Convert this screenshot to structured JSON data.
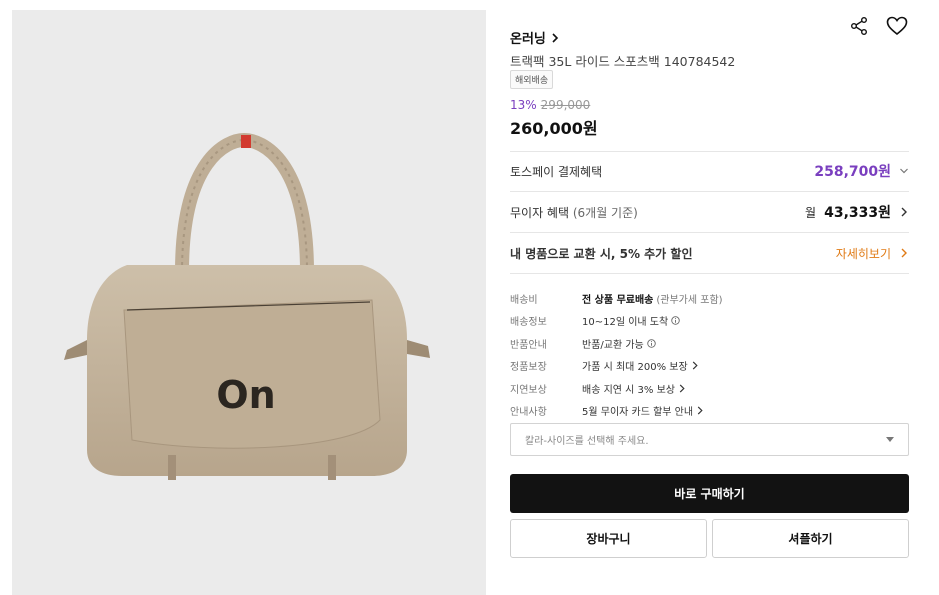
{
  "product": {
    "brand": "온러닝",
    "name": "트랙팩 35L 라이드 스포츠백 140784542",
    "badge": "해외배송",
    "discount_rate": "13%",
    "original_price": "299,000",
    "price": "260,000원"
  },
  "benefits": {
    "toss_label": "토스페이 결제혜택",
    "toss_price": "258,700원",
    "muija_label": "무이자 혜택",
    "muija_sub": "(6개월 기준)",
    "muija_unit": "월",
    "muija_price": "43,333원",
    "promo_label": "내 명품으로 교환 시, 5% 추가 할인",
    "promo_link": "자세히보기"
  },
  "delivery": [
    {
      "key": "배송비",
      "bold": "전 상품 무료배송",
      "muted": "(관부가세 포함)",
      "value": "",
      "icon": "none"
    },
    {
      "key": "배송정보",
      "bold": "",
      "muted": "",
      "value": "10~12일 이내 도착",
      "icon": "info-icon"
    },
    {
      "key": "반품안내",
      "bold": "",
      "muted": "",
      "value": "반품/교환 가능",
      "icon": "info-icon"
    },
    {
      "key": "정품보장",
      "bold": "",
      "muted": "",
      "value": "가품 시 최대 200% 보장",
      "icon": "chevron-right-icon"
    },
    {
      "key": "지연보상",
      "bold": "",
      "muted": "",
      "value": "배송 지연 시 3% 보상",
      "icon": "chevron-right-icon"
    },
    {
      "key": "안내사항",
      "bold": "",
      "muted": "",
      "value": "5월 무이자 카드 할부 안내",
      "icon": "chevron-right-icon"
    }
  ],
  "option_select": {
    "placeholder": "칼라-사이즈를 선택해 주세요."
  },
  "buttons": {
    "buy": "바로 구매하기",
    "cart": "장바구니",
    "gift": "셔플하기"
  },
  "product_image": {
    "logo_text": "On"
  },
  "colors": {
    "accent_purple": "#7a3fbf",
    "promo_orange": "#e07b16",
    "buy_button": "#121212",
    "bag": "#c4b49d"
  }
}
